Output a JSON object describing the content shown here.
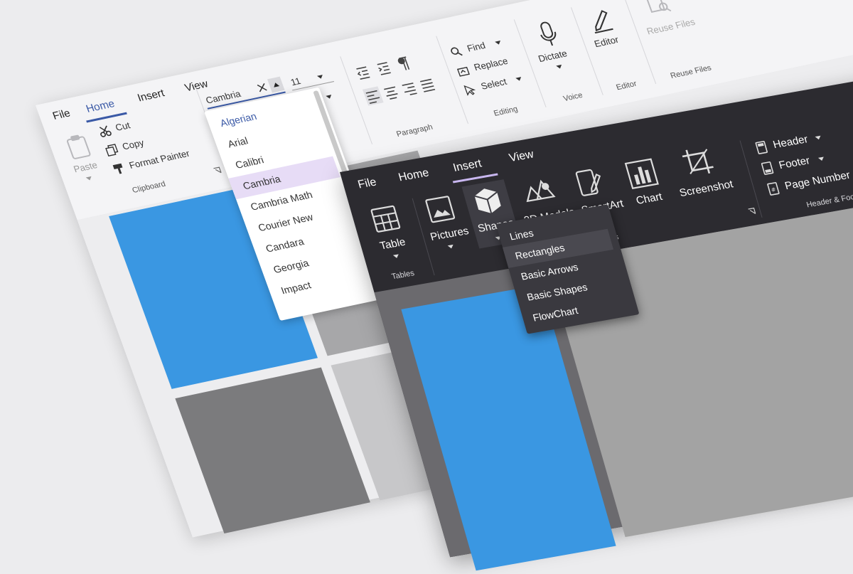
{
  "light": {
    "tabs": [
      "File",
      "Home",
      "Insert",
      "View"
    ],
    "clipboard": {
      "paste": "Paste",
      "cut": "Cut",
      "copy": "Copy",
      "format_painter": "Format Painter",
      "group": "Clipboard"
    },
    "font": {
      "value": "Cambria",
      "size": "11"
    },
    "font_list": [
      "Algerian",
      "Arial",
      "Calibri",
      "Cambria",
      "Cambria Math",
      "Courier New",
      "Candara",
      "Georgia",
      "Impact"
    ],
    "font_selected": "Cambria",
    "paragraph_group": "Paragraph",
    "editing": {
      "find": "Find",
      "replace": "Replace",
      "select": "Select",
      "group": "Editing"
    },
    "voice": {
      "dictate": "Dictate",
      "group": "Voice"
    },
    "editor": {
      "label": "Editor",
      "group": "Editor"
    },
    "reuse": {
      "label": "Reuse Files",
      "group": "Reuse Files"
    }
  },
  "dark": {
    "tabs": [
      "File",
      "Home",
      "Insert",
      "View"
    ],
    "tables": {
      "table": "Table",
      "group": "Tables"
    },
    "pictures": "Pictures",
    "shapes": "Shapes",
    "models": "3D Models",
    "smartart": "SmartArt",
    "chart": "Chart",
    "screenshot": "Screenshot",
    "illustrations_group_partial": "ons",
    "header_footer": {
      "header": "Header",
      "footer": "Footer",
      "page_number": "Page Number",
      "group": "Header & Footer"
    },
    "shapes_list": [
      "Lines",
      "Rectangles",
      "Basic Arrows",
      "Basic Shapes",
      "FlowChart"
    ],
    "shapes_highlighted": "Rectangles"
  },
  "colors": {
    "accent_light": "#3a59a6",
    "accent_dark": "#c9b7f0",
    "selected_font": "#e7dcf6",
    "blue_block": "#3a97e2"
  }
}
